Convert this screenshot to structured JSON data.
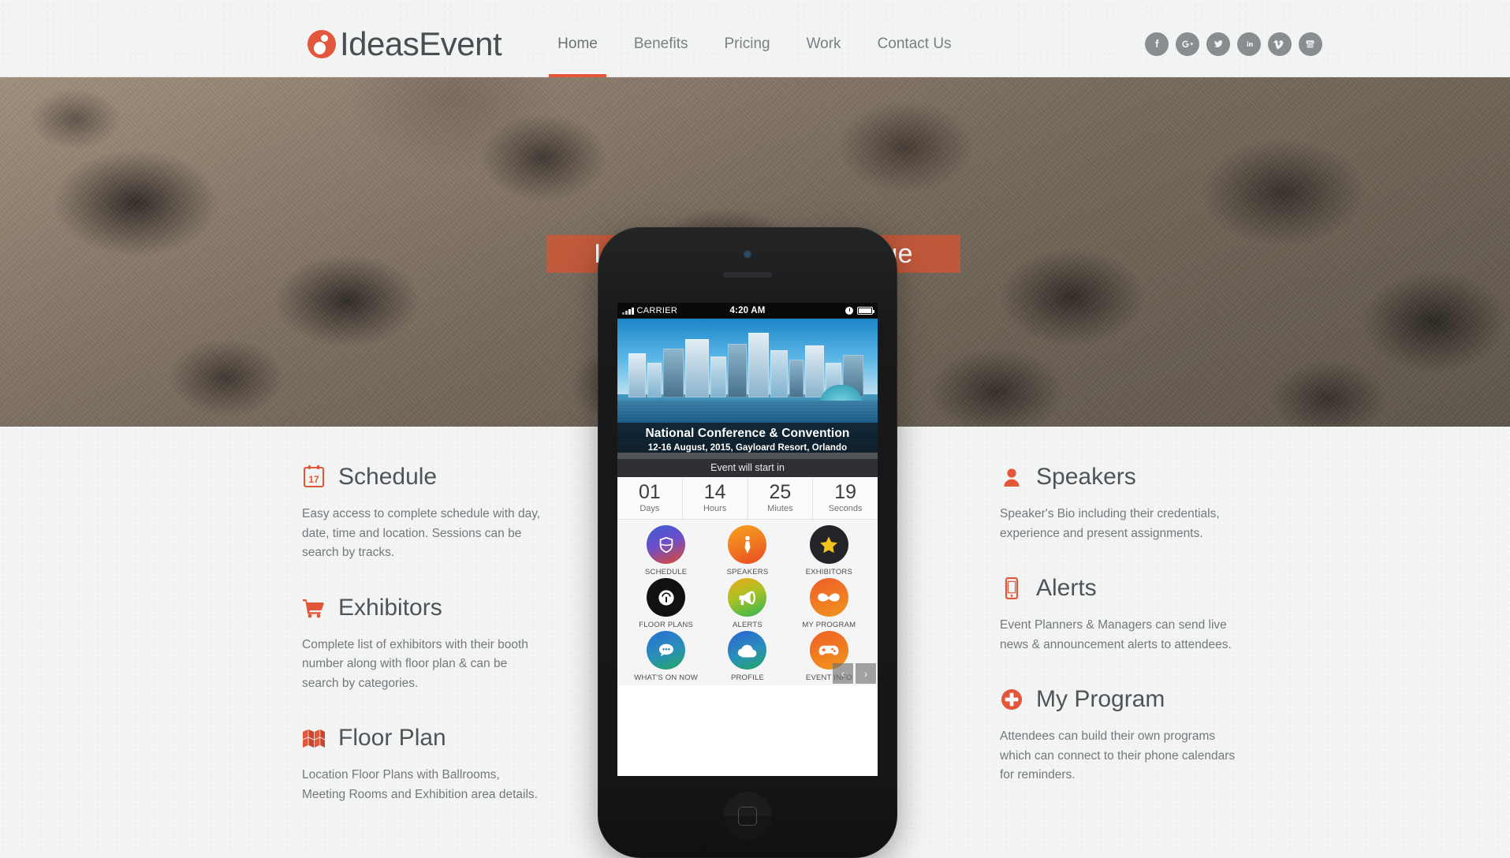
{
  "header": {
    "brand": "IdeasEvent",
    "nav": [
      {
        "label": "Home",
        "active": true
      },
      {
        "label": "Benefits",
        "active": false
      },
      {
        "label": "Pricing",
        "active": false
      },
      {
        "label": "Work",
        "active": false
      },
      {
        "label": "Contact Us",
        "active": false
      }
    ],
    "socials": [
      {
        "name": "facebook-icon",
        "label": "Facebook"
      },
      {
        "name": "google-plus-icon",
        "label": "Google Plus"
      },
      {
        "name": "twitter-icon",
        "label": "Twitter"
      },
      {
        "name": "linkedin-icon",
        "label": "LinkedIn"
      },
      {
        "name": "vimeo-icon",
        "label": "Vimeo"
      },
      {
        "name": "youtube-icon",
        "label": "YouTube"
      }
    ],
    "accent_color": "#e2573a",
    "background_color": "#f2f3f3"
  },
  "hero": {
    "headline": "Let's Connect and Engage",
    "banner_color": "#d65432"
  },
  "features_left": [
    {
      "icon": "calendar-icon",
      "icon_text": "17",
      "title": "Schedule",
      "body": "Easy access to complete schedule with day, date, time and location. Sessions can be search by tracks."
    },
    {
      "icon": "shopping-cart-icon",
      "title": "Exhibitors",
      "body": "Complete list of exhibitors with their booth number along with floor plan & can be search by categories."
    },
    {
      "icon": "map-fold-icon",
      "title": "Floor Plan",
      "body": "Location Floor Plans with Ballrooms, Meeting Rooms and Exhibition area details."
    }
  ],
  "features_right": [
    {
      "icon": "user-icon",
      "title": "Speakers",
      "body": "Speaker's Bio including their credentials, experience and present assignments."
    },
    {
      "icon": "mobile-phone-icon",
      "title": "Alerts",
      "body": "Event Planners & Managers can send live news & announcement alerts to attendees."
    },
    {
      "icon": "plus-circle-icon",
      "title": "My Program",
      "body": "Attendees can build their own programs which can connect to their phone calendars for reminders."
    }
  ],
  "phone": {
    "statusbar": {
      "carrier": "CARRIER",
      "time": "4:20 AM"
    },
    "event": {
      "title": "National Conference & Convention",
      "subtitle": "12-16 August, 2015, Gayloard Resort, Orlando",
      "countdown_label": "Event will start in"
    },
    "countdown": [
      {
        "value": "01",
        "unit": "Days"
      },
      {
        "value": "14",
        "unit": "Hours"
      },
      {
        "value": "25",
        "unit": "Miutes"
      },
      {
        "value": "19",
        "unit": "Seconds"
      }
    ],
    "tiles": [
      {
        "label": "SCHEDULE",
        "icon": "shield-icon"
      },
      {
        "label": "SPEAKERS",
        "icon": "necktie-icon"
      },
      {
        "label": "EXHIBITORS",
        "icon": "star-icon"
      },
      {
        "label": "FLOOR PLANS",
        "icon": "compass-icon"
      },
      {
        "label": "ALERTS",
        "icon": "megaphone-icon"
      },
      {
        "label": "MY PROGRAM",
        "icon": "mustache-icon"
      },
      {
        "label": "WHAT'S ON NOW",
        "icon": "chat-bubble-icon"
      },
      {
        "label": "PROFILE",
        "icon": "cloud-icon"
      },
      {
        "label": "EVENT INFO",
        "icon": "game-controller-icon"
      }
    ],
    "carousel": {
      "prev": "‹",
      "next": "›"
    }
  }
}
